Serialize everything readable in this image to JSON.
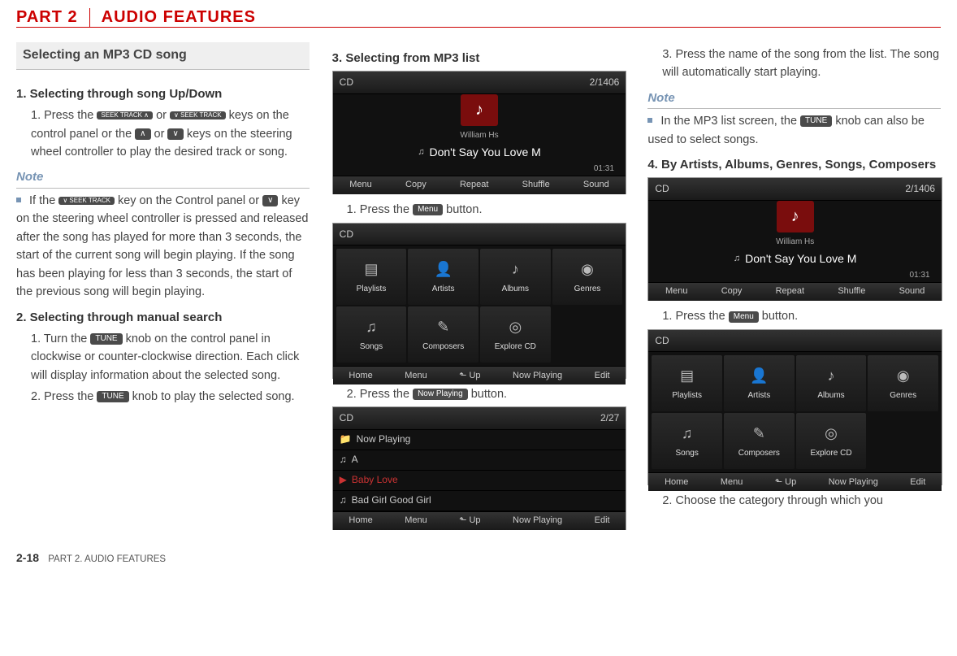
{
  "header": {
    "part": "PART 2",
    "title": "AUDIO FEATURES"
  },
  "section_box": "Selecting an MP3 CD song",
  "col1": {
    "h1": "1. Selecting through song Up/Down",
    "s1a": "1. Press the ",
    "k_seek_up": "SEEK TRACK ∧",
    "s1b": " or ",
    "k_seek_dn": "∨ SEEK TRACK",
    "s1c": " keys on the control panel or the ",
    "k_up": "∧",
    "s1d": " or ",
    "k_dn": "∨",
    "s1e": " keys on the steering wheel controller to play the desired track or song.",
    "note": "Note",
    "n1a": "If the ",
    "n1b": " key on the Control panel or ",
    "n1c": " key on the steering wheel controller is pressed and released after the song has played for more than 3 seconds, the start of the current song will begin playing. If the song has been playing for less than 3 seconds, the start of the previous song will begin playing.",
    "h2": "2. Selecting through manual search",
    "s2a": "1. Turn the ",
    "k_tune": "TUNE",
    "s2b": " knob on the control panel in clockwise or counter-clockwise direction. Each click will display information about the selected song.",
    "s2c": "2. Press the ",
    "s2d": " knob to play the selected song."
  },
  "col2": {
    "h3": "3. Selecting from MP3 list",
    "s1a": "1. Press the ",
    "k_menu": "Menu",
    "s1b": " button.",
    "s2a": "2. Press the ",
    "k_now": "Now Playing",
    "s2b": " button."
  },
  "col3": {
    "s3": "3. Press the name of the song from the list. The song will automatically start playing.",
    "note": "Note",
    "n1a": "In the MP3 list screen, the ",
    "k_tune": "TUNE",
    "n1b": " knob can also be used to select songs.",
    "h4": "4. By Artists, Albums, Genres, Songs, Composers",
    "s1a": "1. Press the ",
    "k_menu": "Menu",
    "s1b": " button.",
    "s2": "2. Choose the category through which you"
  },
  "sshot": {
    "cd": "CD",
    "count": "2/1406",
    "count2": "2/27",
    "artist": "William Hs",
    "song": "Don't Say You Love M",
    "time": "01:31",
    "menu": "Menu",
    "copy": "Copy",
    "repeat": "Repeat",
    "shuffle": "Shuffle",
    "sound": "Sound",
    "home": "Home",
    "up": "Up",
    "nowplaying": "Now Playing",
    "edit": "Edit",
    "playlists": "Playlists",
    "artists": "Artists",
    "albums": "Albums",
    "genres": "Genres",
    "songs": "Songs",
    "composers": "Composers",
    "explore": "Explore CD",
    "listhead": "Now Playing",
    "row1": "A",
    "row2": "Baby Love",
    "row3": "Bad Girl Good Girl"
  },
  "footer": {
    "page": "2-18",
    "label": "PART 2. AUDIO FEATURES"
  }
}
